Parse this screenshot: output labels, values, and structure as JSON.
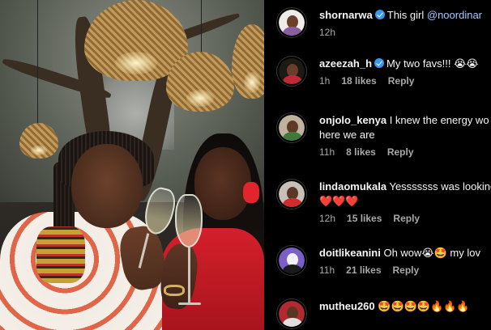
{
  "comments": [
    {
      "username": "shornarwa",
      "verified": true,
      "text": "This girl ",
      "mention": "@noordinar",
      "time": "12h",
      "likes": "",
      "reply": ""
    },
    {
      "username": "azeezah_h",
      "verified": true,
      "text": "My two favs!!! 😭😭",
      "time": "1h",
      "likes": "18 likes",
      "reply": "Reply"
    },
    {
      "username": "onjolo_kenya",
      "verified": false,
      "text": "I knew the energy wo",
      "text2": "here we are",
      "time": "11h",
      "likes": "8 likes",
      "reply": "Reply"
    },
    {
      "username": "lindaomukala",
      "verified": false,
      "text": "Yesssssss was looking",
      "text2": "❤️❤️❤️",
      "time": "12h",
      "likes": "15 likes",
      "reply": "Reply"
    },
    {
      "username": "doitlikeanini",
      "verified": false,
      "text": "Oh wow😭🤩 my lov",
      "time": "11h",
      "likes": "21 likes",
      "reply": "Reply"
    },
    {
      "username": "mutheu260",
      "verified": false,
      "text": "🤩🤩🤩🤩🔥🔥🔥"
    }
  ],
  "avatar_colors": [
    "#f0ede9",
    "#1d1a16",
    "#bfb3a0",
    "#c8c0b8",
    "#7b5fc8",
    "#b02a2f"
  ]
}
